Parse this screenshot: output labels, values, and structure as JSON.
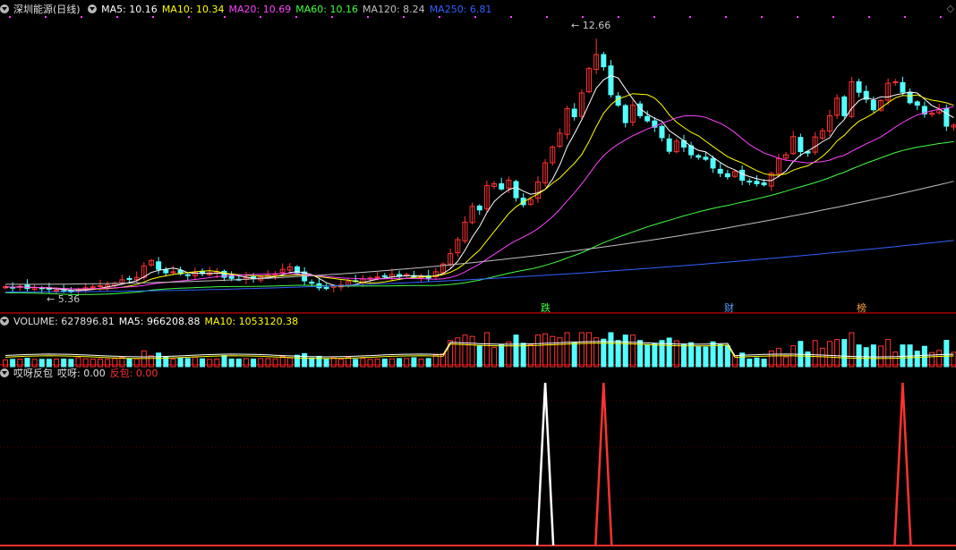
{
  "price_panel": {
    "stock_name": "深圳能源",
    "period": "(日线)",
    "ma_labels": [
      {
        "text": "MA5: 10.16",
        "color": "#ffffff"
      },
      {
        "text": "MA10: 10.34",
        "color": "#ffff00"
      },
      {
        "text": "MA20: 10.69",
        "color": "#ff40ff"
      },
      {
        "text": "MA60: 10.16",
        "color": "#40ff40"
      },
      {
        "text": "MA120: 8.24",
        "color": "#c0c0c0"
      },
      {
        "text": "MA250: 6.81",
        "color": "#3060ff"
      }
    ],
    "high_label": "12.66",
    "low_label": "5.36",
    "event_tags": [
      {
        "text": "跌",
        "color": "#40ff40"
      },
      {
        "text": "财",
        "color": "#5aa0ff"
      },
      {
        "text": "榜",
        "color": "#ffa040"
      }
    ]
  },
  "volume_panel": {
    "title": "VOLUME: 627896.81",
    "ma5": "MA5: 966208.88",
    "ma10": "MA10: 1053120.38"
  },
  "signal_panel": {
    "title": "哎呀反包",
    "series1": "哎呀: 0.00",
    "series2": "反包: 0.00"
  },
  "colors": {
    "up": "#ff3232",
    "down": "#54ffff",
    "bg": "#000000",
    "grid": "#8b0000",
    "ma5": "#ffffff",
    "ma10": "#ffff00",
    "ma20": "#ff40ff",
    "ma60": "#40ff40",
    "ma120": "#c0c0c0",
    "ma250": "#3060ff"
  },
  "chart_data": {
    "type": "candlestick",
    "price_high": 12.66,
    "price_low": 5.36,
    "closes": [
      5.55,
      5.53,
      5.56,
      5.5,
      5.52,
      5.5,
      5.48,
      5.45,
      5.42,
      5.4,
      5.48,
      5.52,
      5.55,
      5.58,
      5.6,
      5.65,
      5.75,
      5.78,
      5.82,
      6.15,
      6.3,
      6.05,
      5.95,
      5.98,
      5.92,
      5.87,
      5.97,
      5.93,
      5.95,
      5.98,
      5.82,
      5.79,
      5.76,
      5.81,
      5.78,
      5.83,
      5.88,
      5.92,
      6.05,
      6.12,
      5.95,
      5.72,
      5.65,
      5.52,
      5.5,
      5.57,
      5.6,
      5.7,
      5.72,
      5.78,
      5.8,
      5.83,
      5.86,
      5.9,
      5.85,
      5.9,
      5.82,
      5.85,
      5.8,
      5.98,
      6.2,
      6.5,
      6.9,
      7.4,
      7.85,
      7.75,
      8.45,
      8.5,
      8.35,
      8.6,
      8.1,
      7.9,
      8.05,
      8.55,
      9.1,
      9.55,
      9.95,
      10.65,
      10.42,
      11.1,
      11.8,
      12.2,
      11.85,
      11.05,
      10.75,
      10.25,
      10.75,
      10.45,
      10.3,
      10.12,
      9.82,
      9.43,
      9.72,
      9.55,
      9.33,
      9.26,
      9.2,
      8.95,
      8.8,
      8.7,
      8.85,
      8.6,
      8.57,
      8.5,
      8.47,
      8.8,
      9.22,
      9.33,
      9.85,
      9.42,
      9.38,
      9.84,
      10.02,
      10.45,
      10.95,
      10.45,
      11.42,
      11.12,
      10.92,
      10.62,
      10.88,
      11.38,
      11.42,
      11.12,
      10.82,
      10.75,
      10.5,
      10.52,
      10.62,
      10.15,
      10.18
    ],
    "volume_ma5": 966208.88,
    "volume_ma10": 1053120.38,
    "signals": [
      {
        "name": "哎呀",
        "color": "#ffffff",
        "index": 74
      },
      {
        "name": "反包",
        "color": "#ff3232",
        "index": 82
      },
      {
        "name": "反包",
        "color": "#ff3232",
        "index": 123
      }
    ]
  }
}
